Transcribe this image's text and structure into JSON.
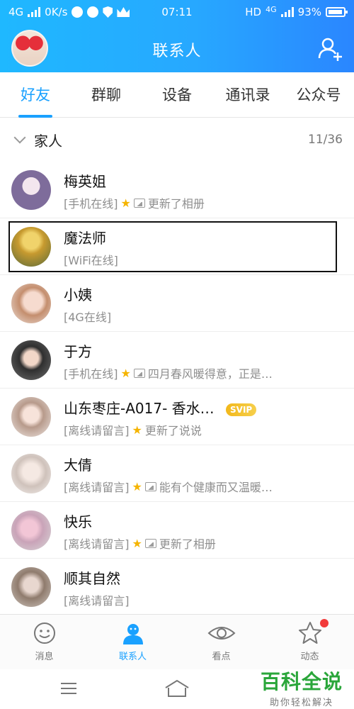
{
  "status_bar": {
    "network": "4G",
    "speed": "0K/s",
    "time": "07:11",
    "hd": "HD",
    "net2": "4G",
    "battery": "93%"
  },
  "header": {
    "title": "联系人"
  },
  "tabs": [
    {
      "label": "好友"
    },
    {
      "label": "群聊"
    },
    {
      "label": "设备"
    },
    {
      "label": "通讯录"
    },
    {
      "label": "公众号"
    }
  ],
  "group": {
    "name": "家人",
    "count": "11/36"
  },
  "contacts": [
    {
      "name": "梅英姐",
      "status": "[手机在线]",
      "update": "更新了相册",
      "avatar_color": "#7e6c9b"
    },
    {
      "name": "魔法师",
      "status": "[WiFi在线]",
      "update": "",
      "avatar_color": "#c79a2f"
    },
    {
      "name": "小姨",
      "status": "[4G在线]",
      "update": "",
      "avatar_color": "#e8c9b7"
    },
    {
      "name": "于方",
      "status": "[手机在线]",
      "update": "四月春风暖得意，正是…",
      "avatar_color": "#3b3b3b"
    },
    {
      "name": "山东枣庄-A017- 香水…",
      "status": "[离线请留言]",
      "update": "更新了说说",
      "badge": "SVIP",
      "avatar_color": "#d9c6bd"
    },
    {
      "name": "大倩",
      "status": "[离线请留言]",
      "update": "能有个健康而又温暖…",
      "avatar_color": "#e9e0db"
    },
    {
      "name": "快乐",
      "status": "[离线请留言]",
      "update": "更新了相册",
      "avatar_color": "#d9b6c4"
    },
    {
      "name": "顺其自然",
      "status": "[离线请留言]",
      "update": "",
      "avatar_color": "#9a8a7d"
    }
  ],
  "bottom_nav": [
    {
      "label": "消息"
    },
    {
      "label": "联系人"
    },
    {
      "label": "看点"
    },
    {
      "label": "动态"
    }
  ],
  "watermark": {
    "title": "百科全说",
    "subtitle": "助你轻松解决"
  },
  "colors": {
    "accent": "#1aa1ff",
    "header_start": "#1fb8ff",
    "header_end": "#2a86ff",
    "vip": "#f2b81b",
    "notify": "#f23b3b"
  }
}
